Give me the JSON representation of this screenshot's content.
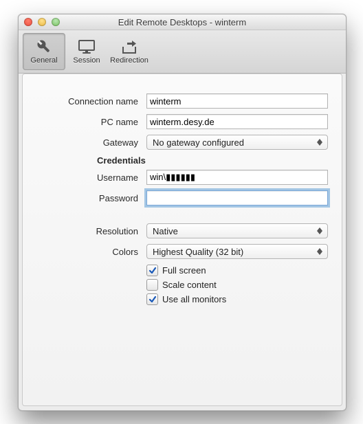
{
  "window": {
    "title": "Edit Remote Desktops - winterm"
  },
  "toolbar": {
    "general": "General",
    "session": "Session",
    "redirection": "Redirection"
  },
  "labels": {
    "connection_name": "Connection name",
    "pc_name": "PC name",
    "gateway": "Gateway",
    "credentials": "Credentials",
    "username": "Username",
    "password": "Password",
    "resolution": "Resolution",
    "colors": "Colors",
    "full_screen": "Full screen",
    "scale_content": "Scale content",
    "use_all_monitors": "Use all monitors"
  },
  "values": {
    "connection_name": "winterm",
    "pc_name": "winterm.desy.de",
    "gateway": "No gateway configured",
    "username": "win\\▮▮▮▮▮▮",
    "password": "",
    "resolution": "Native",
    "colors": "Highest Quality (32 bit)",
    "full_screen_checked": true,
    "scale_content_checked": false,
    "use_all_monitors_checked": true
  }
}
